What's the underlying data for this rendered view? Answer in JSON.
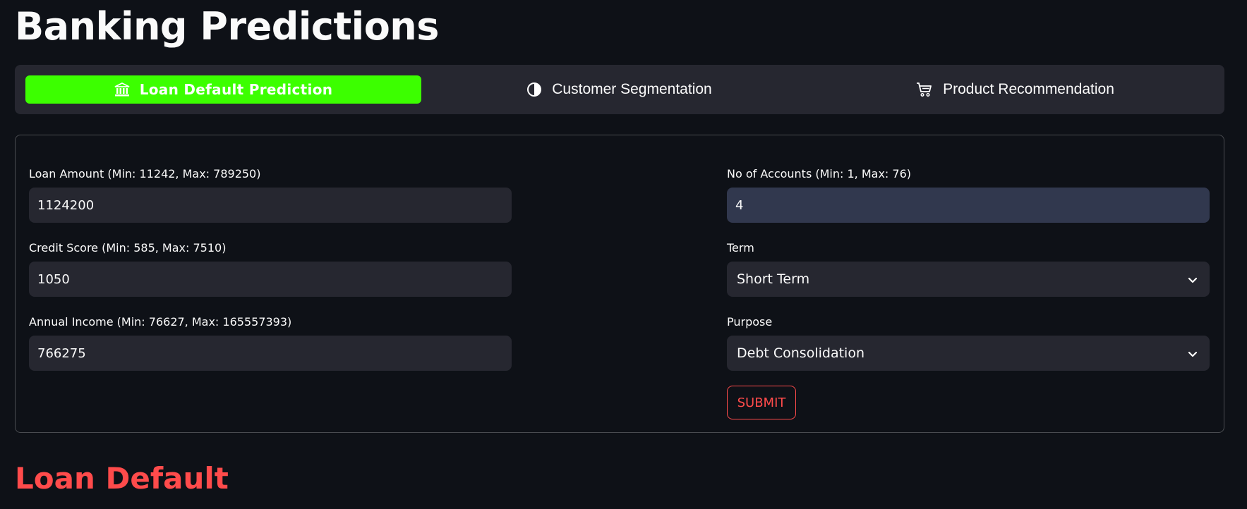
{
  "page": {
    "title": "Banking Predictions"
  },
  "nav": {
    "tabs": [
      {
        "label": "Loan Default Prediction",
        "icon": "bank-icon",
        "active": true
      },
      {
        "label": "Customer Segmentation",
        "icon": "half-circle-icon",
        "active": false
      },
      {
        "label": "Product Recommendation",
        "icon": "cart-icon",
        "active": false
      }
    ]
  },
  "form": {
    "loan_amount": {
      "label": "Loan Amount (Min: 11242, Max: 789250)",
      "value": "1124200"
    },
    "credit_score": {
      "label": "Credit Score (Min: 585, Max: 7510)",
      "value": "1050"
    },
    "annual_income": {
      "label": "Annual Income (Min: 76627, Max: 165557393)",
      "value": "766275"
    },
    "no_of_accounts": {
      "label": "No of Accounts (Min: 1, Max: 76)",
      "value": "4"
    },
    "term": {
      "label": "Term",
      "value": "Short Term"
    },
    "purpose": {
      "label": "Purpose",
      "value": "Debt Consolidation"
    },
    "submit_label": "SUBMIT"
  },
  "result": {
    "title": "Loan Default"
  },
  "colors": {
    "background": "#0e1117",
    "active_tab": "#3cff00",
    "accent": "#ff4b4b",
    "input_bg": "#262730"
  }
}
